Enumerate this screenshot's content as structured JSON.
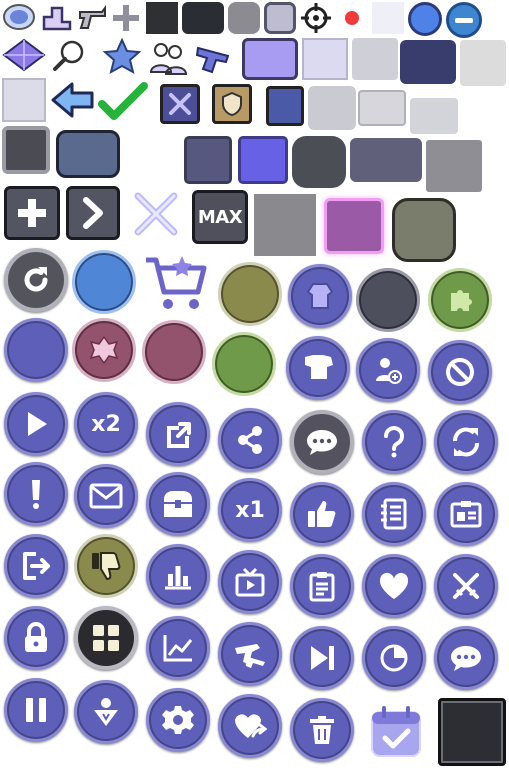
{
  "labels": {
    "max": "MAX",
    "x2": "x2",
    "x1": "x1"
  },
  "colors": {
    "purple_base": "#5e5fb8",
    "purple_rim": "#8889d0",
    "lilac": "#b9b6f6",
    "olive": "#8b8a4d",
    "green": "#6f9a49",
    "mauve": "#93536c",
    "slate": "#4e4f5c",
    "dark": "#2d2e33"
  },
  "icons": [
    "badge-icon",
    "podium-icon",
    "revolver-icon",
    "plus-icon",
    "crosshair-icon",
    "red-dot-icon",
    "no-entry-icon",
    "diamond-icon",
    "magnifier-icon",
    "star-badge-icon",
    "people-icon",
    "pistol-icon",
    "arrow-left-icon",
    "checkmark-icon",
    "swords-icon",
    "shield-badge-icon",
    "plus-button-icon",
    "chevron-right-icon",
    "crossed-swords-glow-icon",
    "max-button-icon",
    "refresh-icon",
    "cart-star-icon",
    "armor-icon",
    "puzzle-icon",
    "emblem-icon",
    "chest-armor-icon",
    "add-user-icon",
    "forbidden-icon",
    "play-icon",
    "upgrade-icon",
    "share-icon",
    "chat-icon",
    "help-icon",
    "swap-icon",
    "alert-icon",
    "mail-icon",
    "chest-icon",
    "thumbs-up-icon",
    "notebook-icon",
    "id-card-icon",
    "exit-icon",
    "thumbs-down-icon",
    "bar-chart-icon",
    "video-icon",
    "clipboard-icon",
    "heart-icon",
    "crossed-swords-icon",
    "lock-icon",
    "grid-icon",
    "line-chart-icon",
    "weapons-icon",
    "skip-icon",
    "pie-chart-icon",
    "message-icon",
    "pause-icon",
    "rank-icon",
    "settings-icon",
    "heart-share-icon",
    "trash-icon",
    "calendar-check-icon"
  ]
}
